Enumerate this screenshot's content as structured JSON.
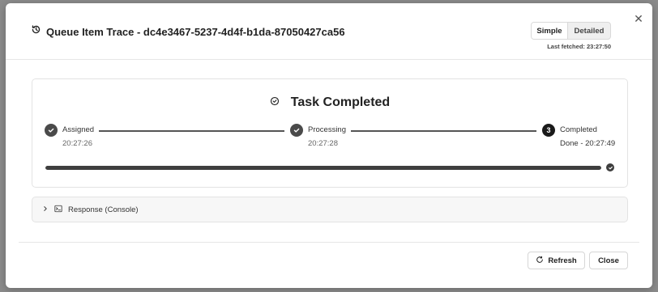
{
  "dialog": {
    "title": "Queue Item Trace - dc4e3467-5237-4d4f-b1da-87050427ca56",
    "close_symbol": "✕",
    "view_toggle": {
      "simple_label": "Simple",
      "detailed_label": "Detailed",
      "active": "Simple"
    },
    "last_fetched": "Last fetched: 23:27:50"
  },
  "status": {
    "title": "Task Completed",
    "steps": [
      {
        "label": "Assigned",
        "time": "20:27:26",
        "state": "done"
      },
      {
        "label": "Processing",
        "time": "20:27:28",
        "state": "done"
      },
      {
        "label": "Completed",
        "number": "3",
        "time": "Done - 20:27:49",
        "state": "current"
      }
    ],
    "progress_fraction": 1.0
  },
  "response_section": {
    "label": "Response (Console)",
    "expanded": false
  },
  "footer": {
    "refresh_label": "Refresh",
    "close_label": "Close"
  },
  "icons": {
    "title": "history-icon",
    "status": "check-circle-icon",
    "step": "check-icon",
    "accordion_chevron": "chevron-right-icon",
    "console": "terminal-icon",
    "refresh": "refresh-icon",
    "close": "close-icon"
  },
  "colors": {
    "primary_dark": "#1a1a1a",
    "step_done": "#4a4a4a",
    "backdrop": "#8a8a8a"
  }
}
